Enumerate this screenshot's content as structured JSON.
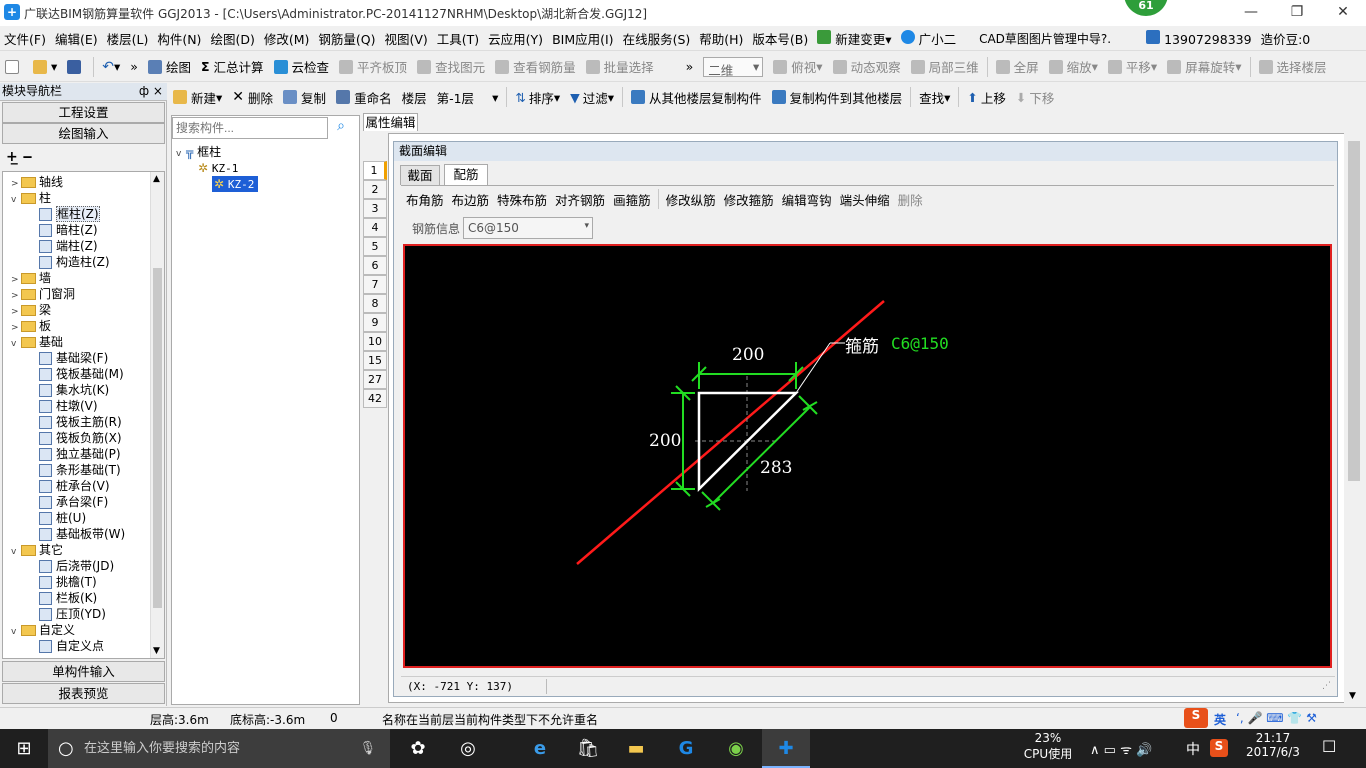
{
  "window": {
    "title": "广联达BIM钢筋算量软件 GGJ2013 - [C:\\Users\\Administrator.PC-20141127NRHM\\Desktop\\湖北新合发.GGJ12]",
    "badge": "61"
  },
  "menu": [
    "文件(F)",
    "编辑(E)",
    "楼层(L)",
    "构件(N)",
    "绘图(D)",
    "修改(M)",
    "钢筋量(Q)",
    "视图(V)",
    "工具(T)",
    "云应用(Y)",
    "BIM应用(I)",
    "在线服务(S)",
    "帮助(H)",
    "版本号(B)",
    "新建变更",
    "广小二",
    "CAD草图图片管理中导?.",
    "13907298339",
    "造价豆:0"
  ],
  "toolbar1": {
    "items": [
      "绘图",
      "汇总计算",
      "云检查",
      "平齐板顶",
      "查找图元",
      "查看钢筋量",
      "批量选择"
    ],
    "view_mode": "二维",
    "right_items": [
      "俯视",
      "动态观察",
      "局部三维",
      "全屏",
      "缩放",
      "平移",
      "屏幕旋转",
      "选择楼层"
    ]
  },
  "toolbar2": {
    "items": [
      "新建",
      "删除",
      "复制",
      "重命名",
      "楼层",
      "第-1层",
      "排序",
      "过滤",
      "从其他楼层复制构件",
      "复制构件到其他楼层",
      "查找",
      "上移",
      "下移"
    ]
  },
  "nav": {
    "title": "模块导航栏",
    "pin": "ф ×",
    "btn_settings": "工程设置",
    "btn_draw": "绘图输入",
    "btn_single": "单构件输入",
    "btn_report": "报表预览",
    "tree": [
      {
        "label": "轴线",
        "level": 0,
        "type": "folder",
        "exp": ">"
      },
      {
        "label": "柱",
        "level": 0,
        "type": "folder",
        "exp": "v"
      },
      {
        "label": "框柱(Z)",
        "level": 1,
        "type": "leaf",
        "selected": true
      },
      {
        "label": "暗柱(Z)",
        "level": 1,
        "type": "leaf"
      },
      {
        "label": "端柱(Z)",
        "level": 1,
        "type": "leaf"
      },
      {
        "label": "构造柱(Z)",
        "level": 1,
        "type": "leaf"
      },
      {
        "label": "墙",
        "level": 0,
        "type": "folder",
        "exp": ">"
      },
      {
        "label": "门窗洞",
        "level": 0,
        "type": "folder",
        "exp": ">"
      },
      {
        "label": "梁",
        "level": 0,
        "type": "folder",
        "exp": ">"
      },
      {
        "label": "板",
        "level": 0,
        "type": "folder",
        "exp": ">"
      },
      {
        "label": "基础",
        "level": 0,
        "type": "folder",
        "exp": "v"
      },
      {
        "label": "基础梁(F)",
        "level": 1,
        "type": "leaf"
      },
      {
        "label": "筏板基础(M)",
        "level": 1,
        "type": "leaf"
      },
      {
        "label": "集水坑(K)",
        "level": 1,
        "type": "leaf"
      },
      {
        "label": "柱墩(V)",
        "level": 1,
        "type": "leaf"
      },
      {
        "label": "筏板主筋(R)",
        "level": 1,
        "type": "leaf"
      },
      {
        "label": "筏板负筋(X)",
        "level": 1,
        "type": "leaf"
      },
      {
        "label": "独立基础(P)",
        "level": 1,
        "type": "leaf"
      },
      {
        "label": "条形基础(T)",
        "level": 1,
        "type": "leaf"
      },
      {
        "label": "桩承台(V)",
        "level": 1,
        "type": "leaf"
      },
      {
        "label": "承台梁(F)",
        "level": 1,
        "type": "leaf"
      },
      {
        "label": "桩(U)",
        "level": 1,
        "type": "leaf"
      },
      {
        "label": "基础板带(W)",
        "level": 1,
        "type": "leaf"
      },
      {
        "label": "其它",
        "level": 0,
        "type": "folder",
        "exp": "v"
      },
      {
        "label": "后浇带(JD)",
        "level": 1,
        "type": "leaf"
      },
      {
        "label": "挑檐(T)",
        "level": 1,
        "type": "leaf"
      },
      {
        "label": "栏板(K)",
        "level": 1,
        "type": "leaf"
      },
      {
        "label": "压顶(YD)",
        "level": 1,
        "type": "leaf"
      },
      {
        "label": "自定义",
        "level": 0,
        "type": "folder",
        "exp": "v"
      },
      {
        "label": "自定义点",
        "level": 1,
        "type": "leaf"
      }
    ]
  },
  "components": {
    "search_placeholder": "搜索构件...",
    "root": "框柱",
    "items": [
      "KZ-1",
      "KZ-2"
    ]
  },
  "property_tab": "属性编辑",
  "row_numbers": [
    "1",
    "2",
    "3",
    "4",
    "5",
    "6",
    "7",
    "8",
    "9",
    "10",
    "15",
    "27",
    "42"
  ],
  "section": {
    "title": "截面编辑",
    "tabs": [
      "截面",
      "配筋"
    ],
    "rebar_tools": [
      "布角筋",
      "布边筋",
      "特殊布筋",
      "对齐钢筋",
      "画箍筋",
      "修改纵筋",
      "修改箍筋",
      "编辑弯钩",
      "端头伸缩",
      "删除"
    ],
    "rebar_info_label": "钢筋信息",
    "rebar_info_value": "C6@150",
    "dim_top": "200",
    "dim_left": "200",
    "dim_diag": "283",
    "stirrup_label": "箍筋",
    "stirrup_value": "C6@150",
    "coords": "(X: -721 Y: 137)"
  },
  "status": {
    "floor_height": "层高:3.6m",
    "base_height": "底标高:-3.6m",
    "zero": "0",
    "message": "名称在当前层当前构件类型下不允许重名"
  },
  "taskbar": {
    "search": "在这里输入你要搜索的内容",
    "cpu_pct": "23%",
    "cpu_label": "CPU使用",
    "ime": "中",
    "time": "21:17",
    "date": "2017/6/3",
    "ime_lang": "英"
  }
}
